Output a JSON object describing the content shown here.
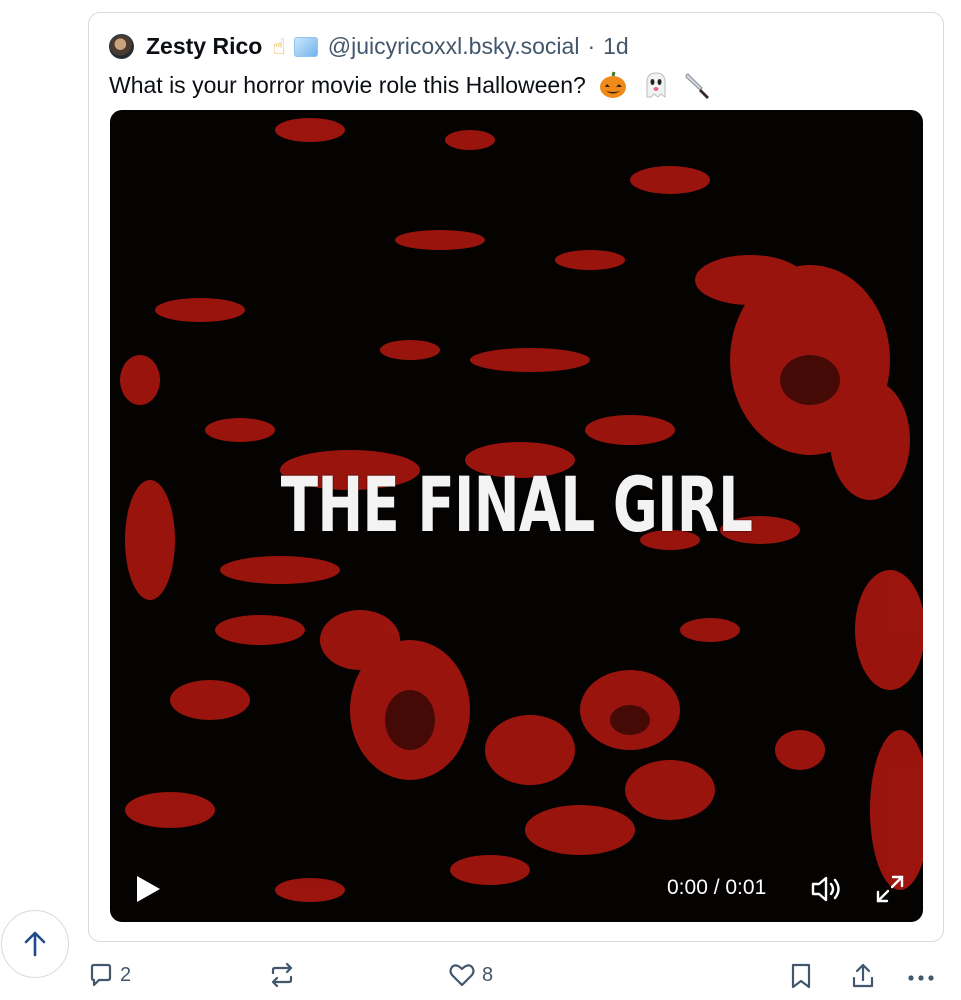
{
  "post": {
    "author_name": "Zesty Rico",
    "badges": [
      "point-up-finger-emoji",
      "ice-cube-emoji"
    ],
    "handle": "@juicyricoxxl.bsky.social",
    "separator": "·",
    "time": "1d",
    "text": "What is your horror movie role this Halloween?",
    "text_emojis": [
      "jack-o-lantern-emoji",
      "ghost-emoji",
      "knife-emoji"
    ]
  },
  "video": {
    "title_overlay": "THE FINAL GIRL",
    "time_display": "0:00 / 0:01",
    "accent_color": "#a3150f"
  },
  "actions": {
    "reply_count": "2",
    "repost_count": "",
    "like_count": "8"
  },
  "icons": {
    "scroll_top": "arrow-up-icon",
    "reply": "speech-bubble-icon",
    "repost": "repost-icon",
    "like": "heart-icon",
    "bookmark": "bookmark-icon",
    "share": "share-icon",
    "more": "ellipsis-icon"
  }
}
